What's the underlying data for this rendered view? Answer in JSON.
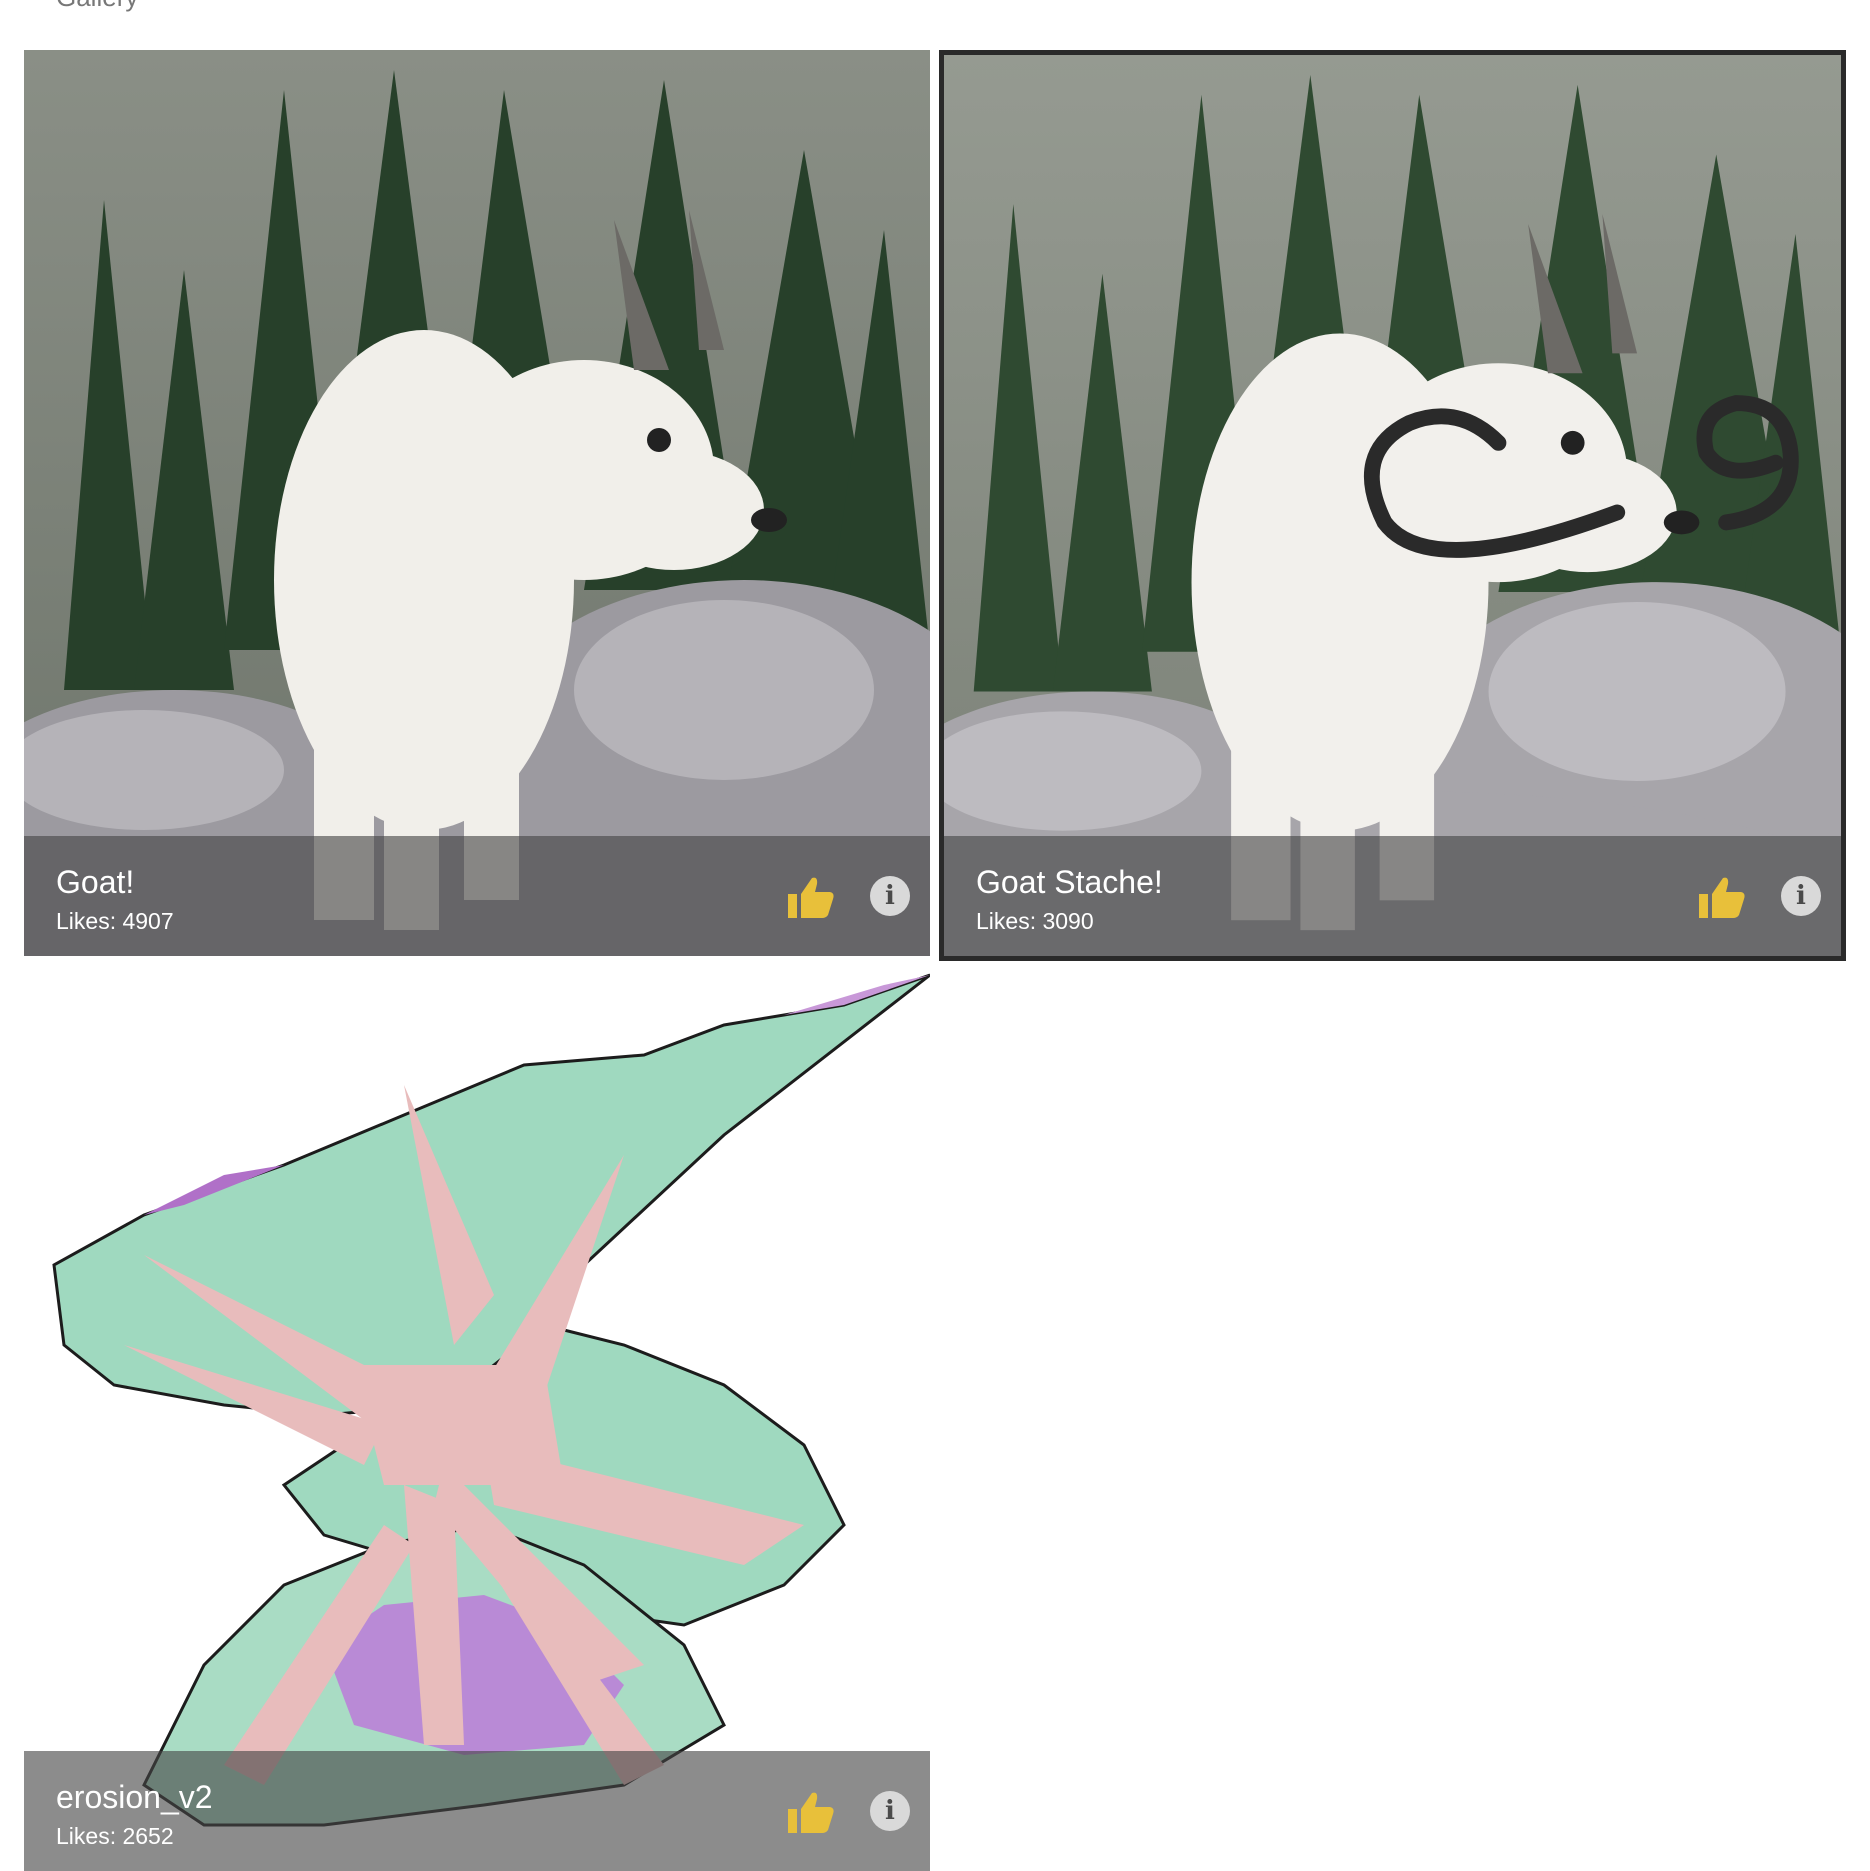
{
  "page": {
    "title": "Gallery"
  },
  "gallery": {
    "accent_color": "#e8c03a",
    "items": [
      {
        "title": "Goat!",
        "likes_text": "Likes: 4907",
        "likes": 4907,
        "image": "mountain-goat-photo",
        "selected": false
      },
      {
        "title": "Goat Stache!",
        "likes_text": "Likes: 3090",
        "likes": 3090,
        "image": "mountain-goat-with-drawn-mustache",
        "selected": true
      },
      {
        "title": "erosion_v2",
        "likes_text": "Likes: 2652",
        "likes": 2652,
        "image": "abstract-green-pink-purple-shape",
        "selected": false
      }
    ],
    "icons": {
      "like": "thumbs-up-icon",
      "info": "info-icon"
    }
  }
}
